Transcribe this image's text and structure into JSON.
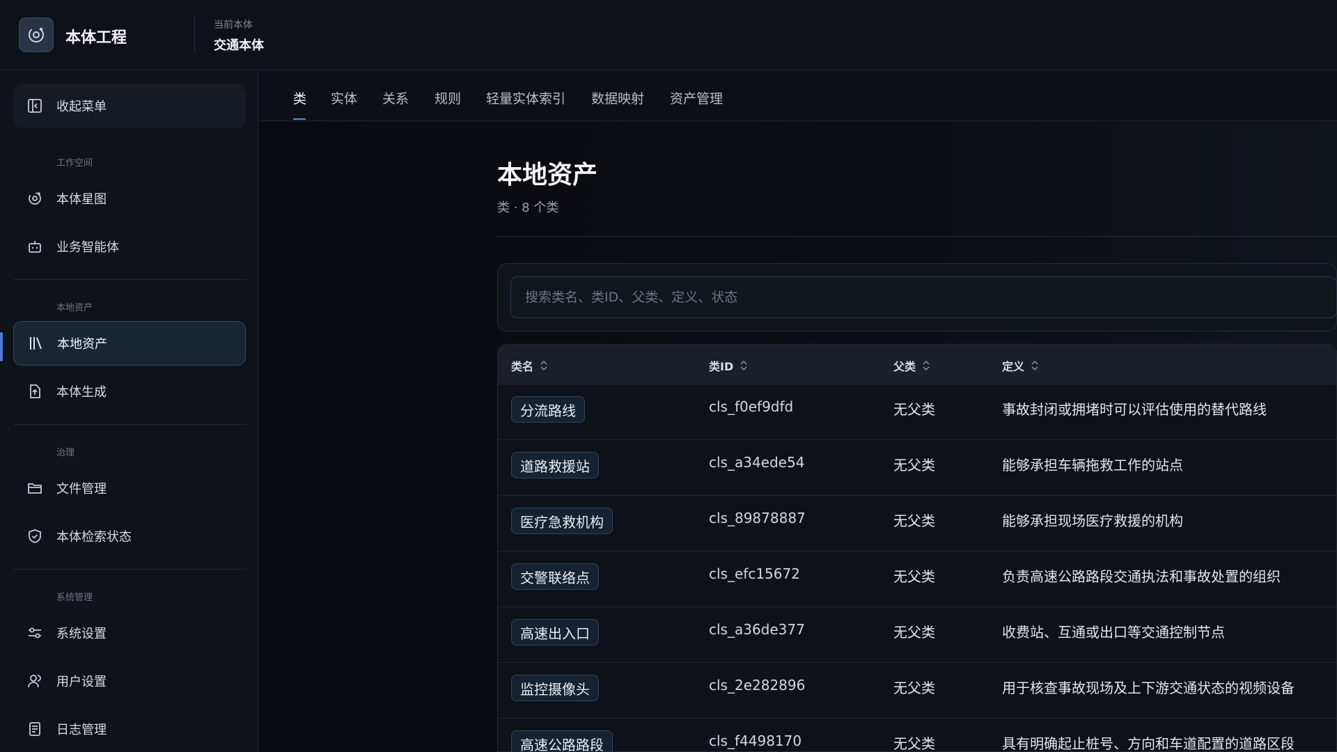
{
  "header": {
    "app_title": "本体工程",
    "ontology_caption": "当前本体",
    "ontology_name": "交通本体"
  },
  "sidebar": {
    "collapse_label": "收起菜单",
    "sections": [
      {
        "title": "工作空间",
        "items": [
          {
            "label": "本体星图",
            "icon": "orbit-icon"
          },
          {
            "label": "业务智能体",
            "icon": "robot-icon"
          }
        ]
      },
      {
        "title": "本地资产",
        "items": [
          {
            "label": "本地资产",
            "icon": "library-icon",
            "active": true
          },
          {
            "label": "本体生成",
            "icon": "file-upload-icon"
          }
        ]
      },
      {
        "title": "治理",
        "items": [
          {
            "label": "文件管理",
            "icon": "folder-icon"
          },
          {
            "label": "本体检索状态",
            "icon": "shield-check-icon"
          }
        ]
      },
      {
        "title": "系统管理",
        "items": [
          {
            "label": "系统设置",
            "icon": "sliders-icon"
          },
          {
            "label": "用户设置",
            "icon": "users-icon"
          },
          {
            "label": "日志管理",
            "icon": "log-icon"
          }
        ]
      }
    ]
  },
  "tabs": [
    "类",
    "实体",
    "关系",
    "规则",
    "轻量实体索引",
    "数据映射",
    "资产管理"
  ],
  "active_tab": "类",
  "page": {
    "title": "本地资产",
    "subtitle": "类 · 8 个类"
  },
  "search": {
    "placeholder": "搜索类名、类ID、父类、定义、状态"
  },
  "table": {
    "headers": [
      "类名",
      "类ID",
      "父类",
      "定义"
    ],
    "rows": [
      {
        "name": "分流路线",
        "id": "cls_f0ef9dfd",
        "parent": "无父类",
        "definition": "事故封闭或拥堵时可以评估使用的替代路线"
      },
      {
        "name": "道路救援站",
        "id": "cls_a34ede54",
        "parent": "无父类",
        "definition": "能够承担车辆拖救工作的站点"
      },
      {
        "name": "医疗急救机构",
        "id": "cls_89878887",
        "parent": "无父类",
        "definition": "能够承担现场医疗救援的机构"
      },
      {
        "name": "交警联络点",
        "id": "cls_efc15672",
        "parent": "无父类",
        "definition": "负责高速公路路段交通执法和事故处置的组织"
      },
      {
        "name": "高速出入口",
        "id": "cls_a36de377",
        "parent": "无父类",
        "definition": "收费站、互通或出口等交通控制节点"
      },
      {
        "name": "监控摄像头",
        "id": "cls_2e282896",
        "parent": "无父类",
        "definition": "用于核查事故现场及上下游交通状态的视频设备"
      },
      {
        "name": "高速公路路段",
        "id": "cls_f4498170",
        "parent": "无父类",
        "definition": "具有明确起止桩号、方向和车道配置的道路区段"
      }
    ]
  },
  "colors": {
    "accent": "#5b8ae6",
    "background": "#0b0d13"
  }
}
